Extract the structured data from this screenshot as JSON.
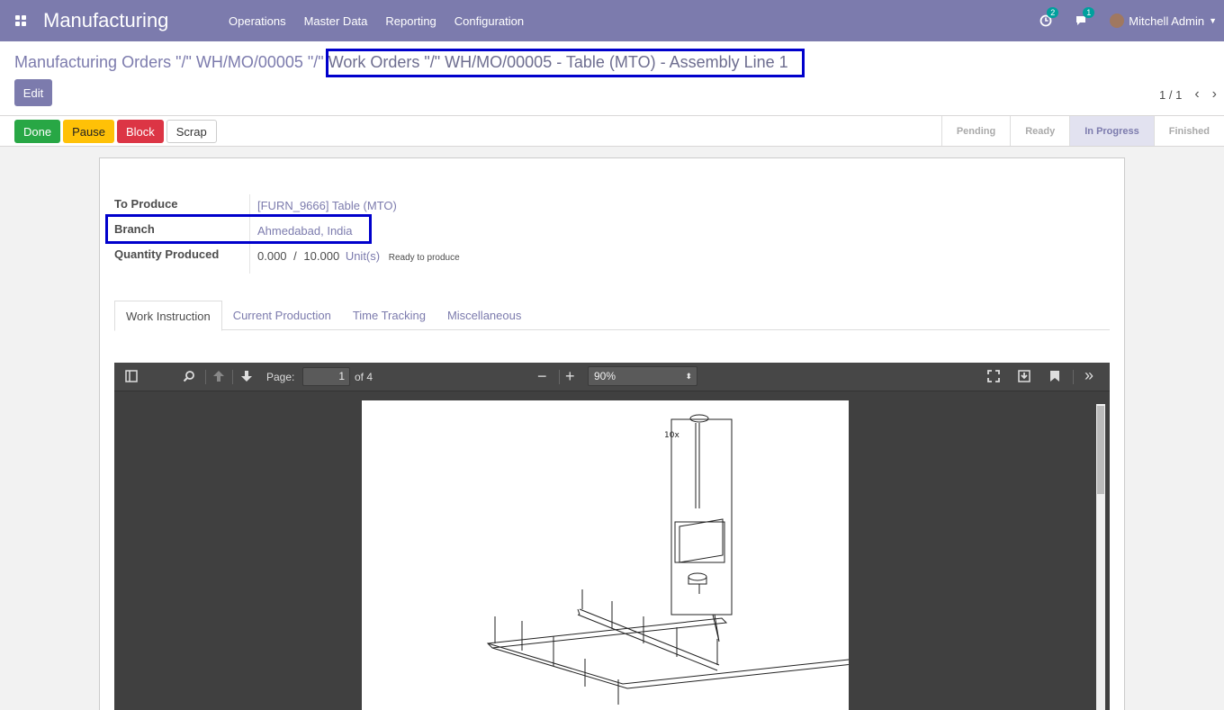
{
  "nav": {
    "app_name": "Manufacturing",
    "menus": [
      "Operations",
      "Master Data",
      "Reporting",
      "Configuration"
    ],
    "activity_count": "2",
    "message_count": "1",
    "user_name": "Mitchell Admin"
  },
  "breadcrumb": {
    "first": "Manufacturing Orders \"/\" WH/MO/00005",
    "sep": " \"/\" ",
    "current": "Work Orders \"/\" WH/MO/00005 - Table (MTO) - Assembly Line 1"
  },
  "edit_label": "Edit",
  "pager": {
    "value": "1 / 1"
  },
  "status_buttons": [
    "Done",
    "Pause",
    "Block",
    "Scrap"
  ],
  "stages": [
    {
      "label": "Pending"
    },
    {
      "label": "Ready"
    },
    {
      "label": "In Progress"
    },
    {
      "label": "Finished"
    }
  ],
  "active_stage": "In Progress",
  "fields": {
    "to_produce_label": "To Produce",
    "to_produce_value": "[FURN_9666] Table (MTO)",
    "branch_label": "Branch",
    "branch_value": "Ahmedabad, India",
    "qty_label": "Quantity Produced",
    "qty_done": "0.000",
    "qty_slash": "/",
    "qty_total": "10.000",
    "qty_uom": "Unit(s)",
    "qty_state": "Ready to produce"
  },
  "tabs": [
    "Work Instruction",
    "Current Production",
    "Time Tracking",
    "Miscellaneous"
  ],
  "pdf": {
    "page_label": "Page:",
    "page_value": "1",
    "of_label": "of 4",
    "zoom": "90%",
    "drawing_label": "10x"
  }
}
